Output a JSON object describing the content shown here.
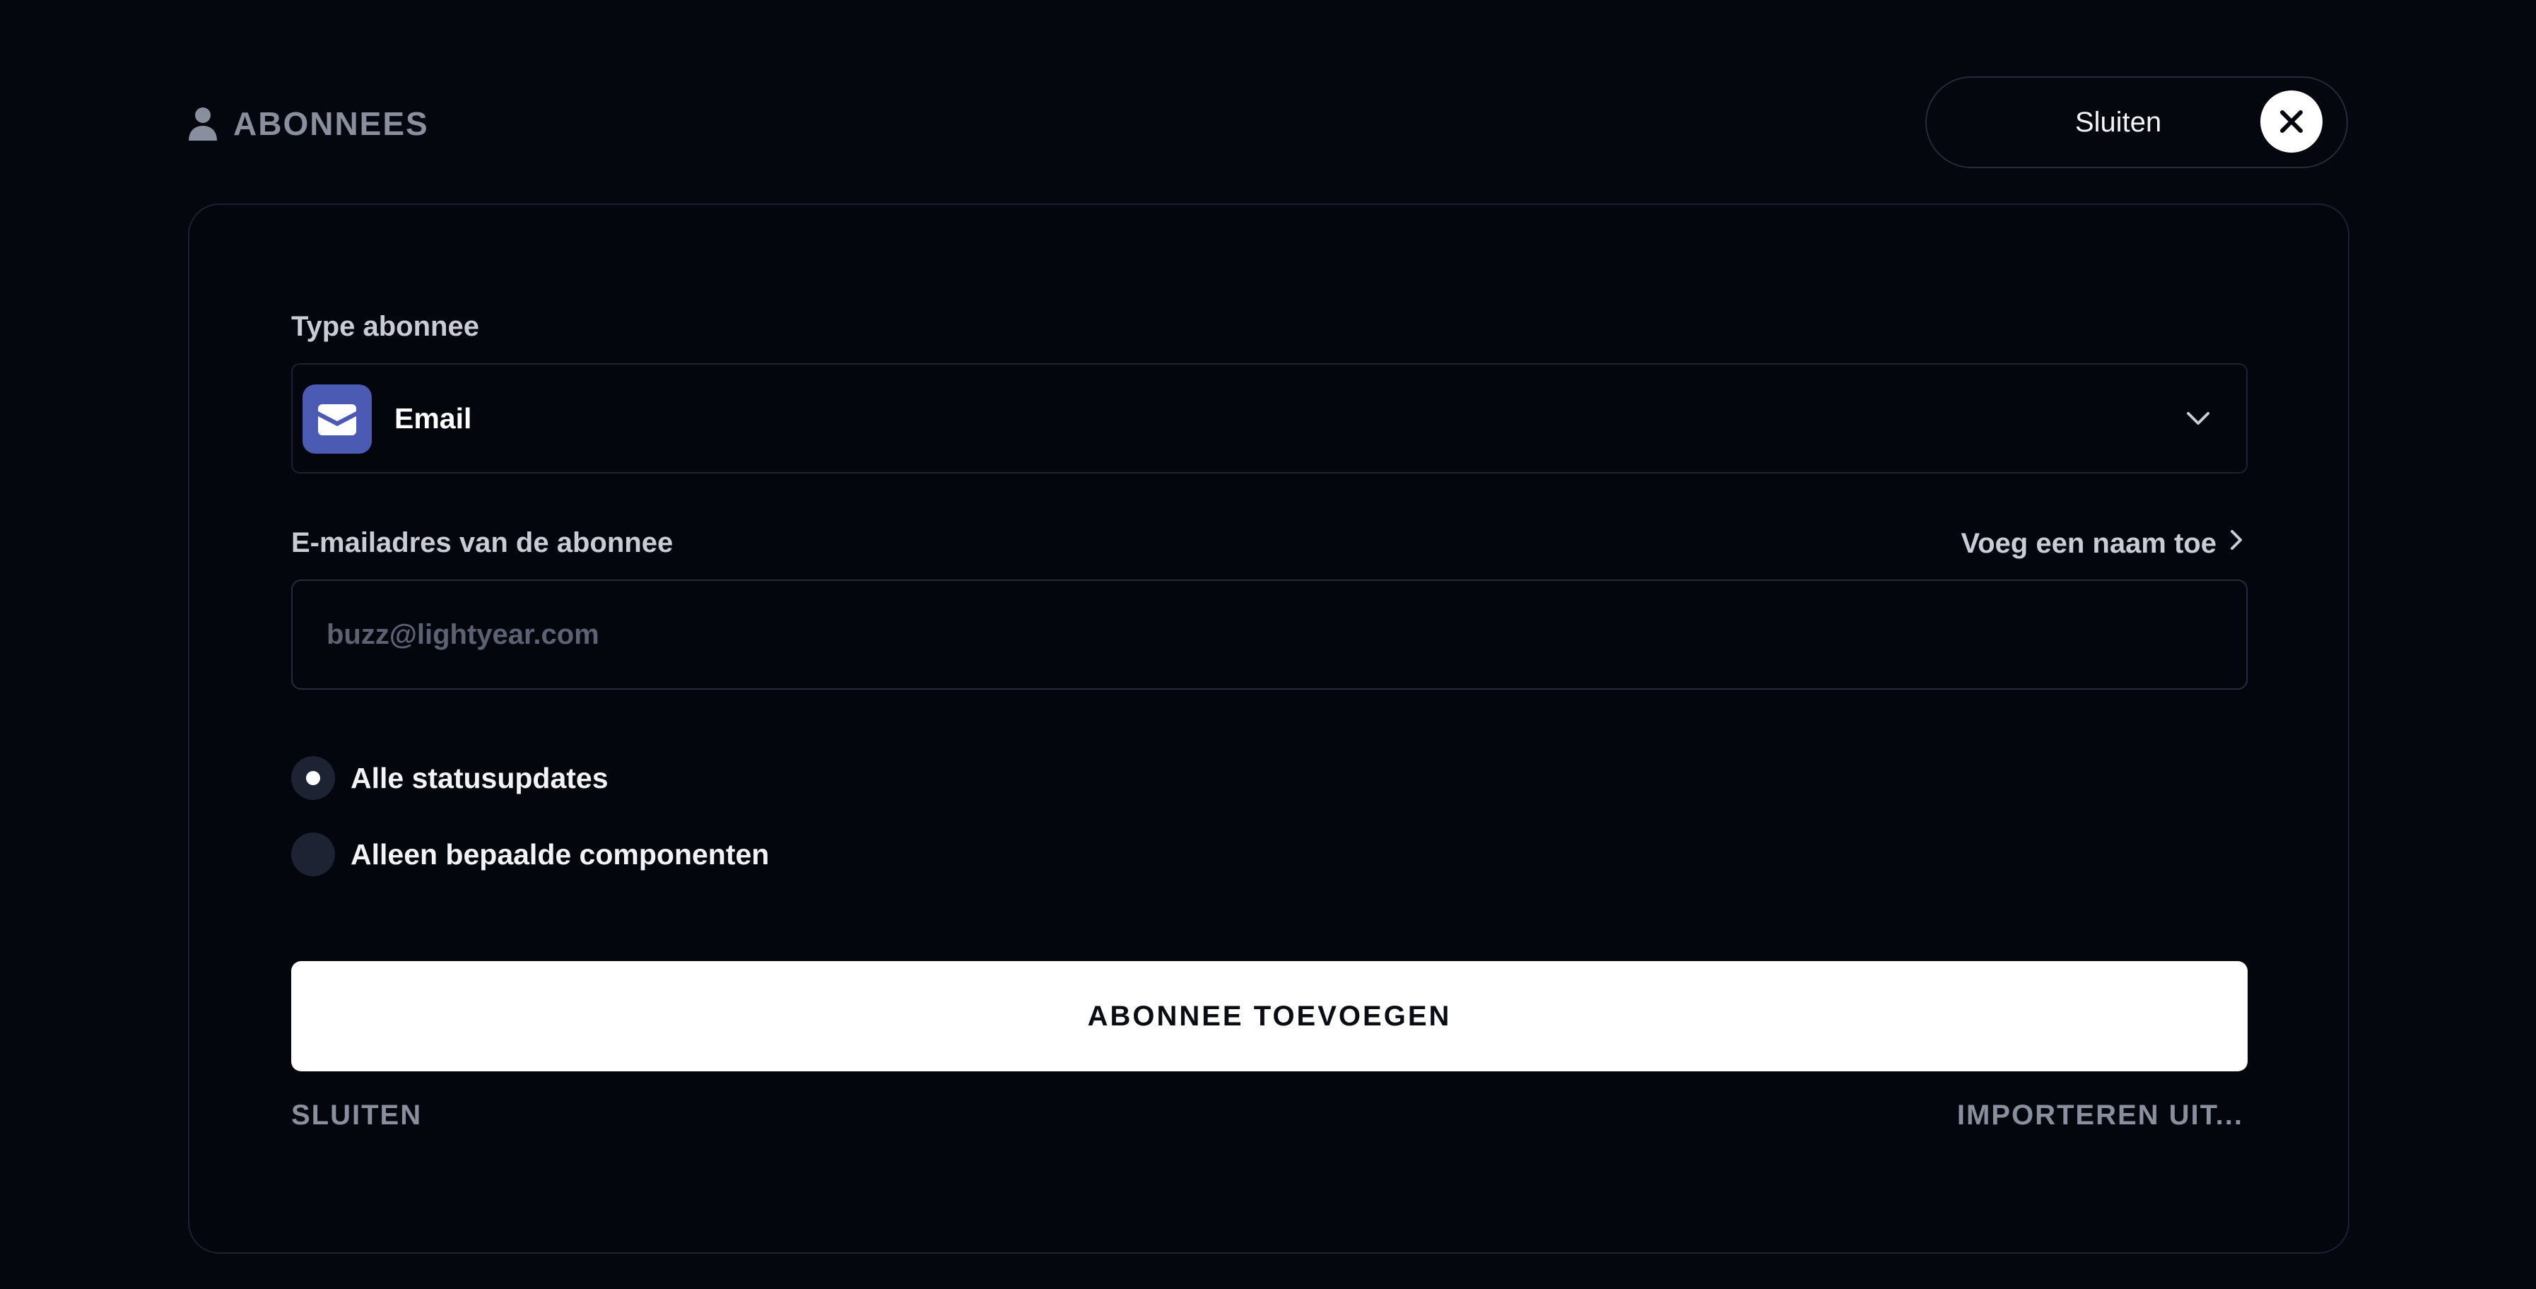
{
  "header": {
    "title": "ABONNEES",
    "close_label": "Sluiten",
    "person_icon": "person-icon",
    "close_icon": "close-icon"
  },
  "form": {
    "type_label": "Type abonnee",
    "type_selected": "Email",
    "type_icon": "envelope-icon",
    "email_label": "E-mailadres van de abonnee",
    "add_name_link": "Voeg een naam toe",
    "email_value": "",
    "email_placeholder": "buzz@lightyear.com",
    "radio_options": [
      {
        "label": "Alle statusupdates",
        "selected": true
      },
      {
        "label": "Alleen bepaalde componenten",
        "selected": false
      }
    ],
    "submit_label": "ABONNEE TOEVOEGEN",
    "close_link": "SLUITEN",
    "import_link": "IMPORTEREN UIT..."
  },
  "colors": {
    "background": "#05070f",
    "accent_badge": "#4b5bb4",
    "button_bg": "#ffffff",
    "muted_text": "#8a8f9d"
  }
}
